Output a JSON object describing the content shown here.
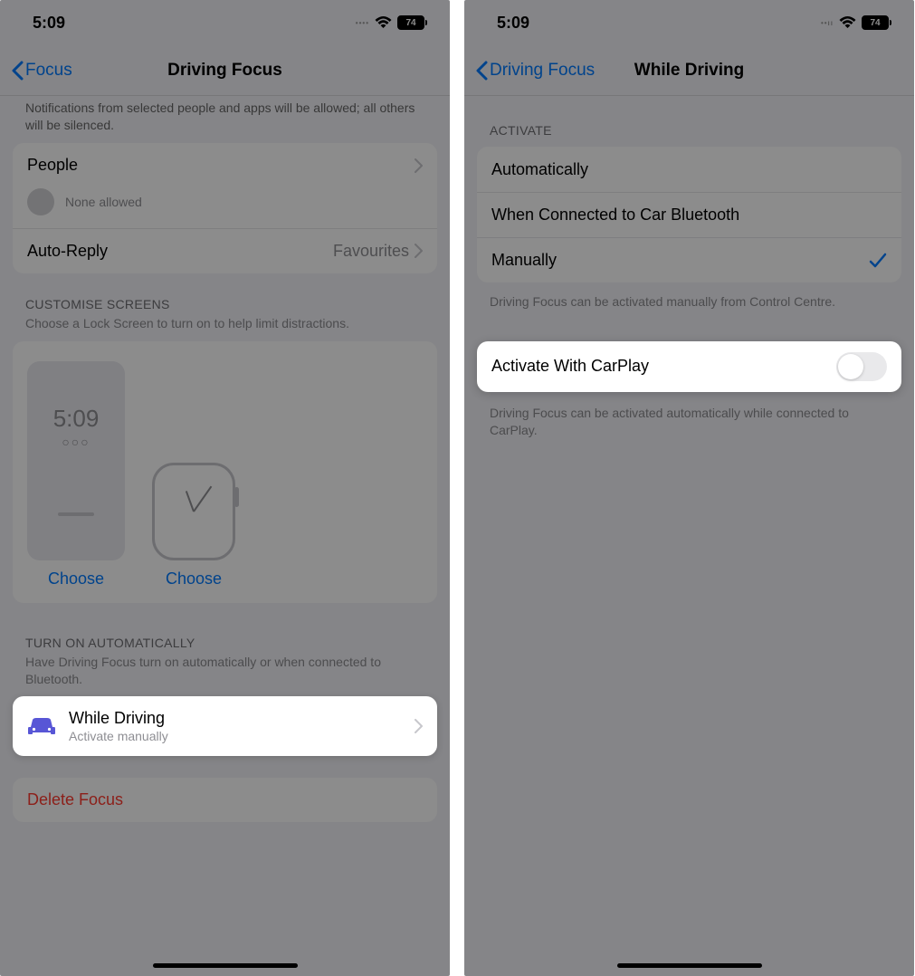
{
  "status": {
    "time": "5:09",
    "battery": "74"
  },
  "left": {
    "nav": {
      "back": "Focus",
      "title": "Driving Focus"
    },
    "notif_descr": "Notifications from selected people and apps will be allowed; all others will be silenced.",
    "people": {
      "label": "People",
      "none": "None allowed"
    },
    "auto_reply": {
      "label": "Auto-Reply",
      "value": "Favourites"
    },
    "customise": {
      "header": "CUSTOMISE SCREENS",
      "sub": "Choose a Lock Screen to turn on to help limit distractions.",
      "preview_time": "5:09",
      "choose": "Choose"
    },
    "auto": {
      "header": "TURN ON AUTOMATICALLY",
      "sub": "Have Driving Focus turn on automatically or when connected to Bluetooth.",
      "while_driving": "While Driving",
      "activate_manually": "Activate manually"
    },
    "delete": "Delete Focus"
  },
  "right": {
    "nav": {
      "back": "Driving Focus",
      "title": "While Driving"
    },
    "activate": {
      "header": "ACTIVATE",
      "options": {
        "auto": "Automatically",
        "bluetooth": "When Connected to Car Bluetooth",
        "manual": "Manually"
      },
      "footer": "Driving Focus can be activated manually from Control Centre."
    },
    "carplay": {
      "label": "Activate With CarPlay",
      "footer": "Driving Focus can be activated automatically while connected to CarPlay."
    }
  }
}
